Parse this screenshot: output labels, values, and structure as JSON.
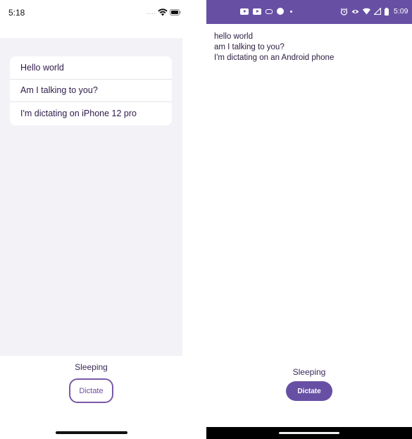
{
  "ios": {
    "status_bar": {
      "time": "5:18",
      "signal_dots": "....",
      "icons": [
        "wifi-icon",
        "battery-icon"
      ]
    },
    "list_items": [
      {
        "text": "Hello world"
      },
      {
        "text": "Am I talking to you?"
      },
      {
        "text": "I'm dictating on iPhone 12 pro"
      }
    ],
    "status_text": "Sleeping",
    "dictate_label": "Dictate",
    "colors": {
      "background": "#f2f2f7",
      "accent": "#7a5aa6",
      "text": "#2f1c4a"
    }
  },
  "android": {
    "status_bar": {
      "time": "5:09",
      "left_icons": [
        "youtube-icon",
        "youtube-icon",
        "pill-icon",
        "spotify-icon",
        "dot-icon"
      ],
      "right_icons": [
        "alarm-icon",
        "eye-icon",
        "wifi-icon",
        "signal-icon",
        "battery-icon"
      ]
    },
    "lines": [
      {
        "text": "hello world"
      },
      {
        "text": "am I talking to you?"
      },
      {
        "text": "I'm dictating on an Android phone"
      }
    ],
    "status_text": "Sleeping",
    "dictate_label": "Dictate",
    "colors": {
      "status_bar": "#6750a4",
      "button": "#6750a4",
      "text": "#2b1d40"
    }
  }
}
